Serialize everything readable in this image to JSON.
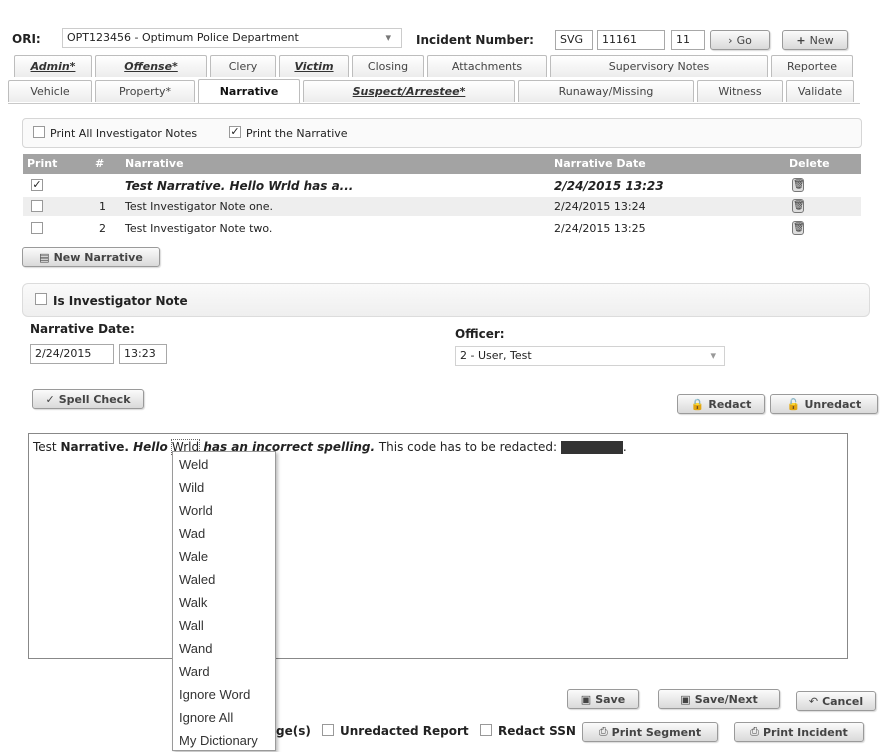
{
  "header": {
    "ori_label": "ORI:",
    "ori_value": "OPT123456 - Optimum Police Department",
    "incident_label": "Incident Number:",
    "incident_prefix": "SVG",
    "incident_number": "11161",
    "incident_suffix": "11",
    "go_label": "Go",
    "new_label": "New"
  },
  "tabs_row1": [
    "Admin*",
    "Offense*",
    "Clery",
    "Victim",
    "Closing",
    "Attachments",
    "Supervisory Notes",
    "Reportee"
  ],
  "tabs_row2": [
    "Vehicle",
    "Property*",
    "Narrative",
    "Suspect/Arrestee*",
    "Runaway/Missing",
    "Witness",
    "Validate"
  ],
  "print_options": {
    "print_all_notes": "Print All Investigator Notes",
    "print_narrative": "Print the Narrative"
  },
  "grid": {
    "headers": {
      "print": "Print",
      "num": "#",
      "narrative": "Narrative",
      "date": "Narrative Date",
      "delete": "Delete"
    },
    "rows": [
      {
        "num": "",
        "narrative": "Test Narrative. Hello Wrld has a...",
        "date": "2/24/2015 13:23"
      },
      {
        "num": "1",
        "narrative": "Test Investigator Note one.",
        "date": "2/24/2015 13:24"
      },
      {
        "num": "2",
        "narrative": "Test Investigator Note two.",
        "date": "2/24/2015 13:25"
      }
    ]
  },
  "new_narrative_label": "New Narrative",
  "form": {
    "investigator_note_label": "Is Investigator Note",
    "narrative_date_label": "Narrative Date:",
    "date_value": "2/24/2015",
    "time_value": "13:23",
    "officer_label": "Officer:",
    "officer_value": "2 - User, Test"
  },
  "toolbar": {
    "spell_check": "Spell Check",
    "redact": "Redact",
    "unredact": "Unredact"
  },
  "editor": {
    "text_1": "Test ",
    "text_2": "Narrative. ",
    "text_3": "Hello ",
    "misspelled": "Wrld",
    "text_4": " has an incorrect spelling.",
    "text_5": " This code has to be redacted: "
  },
  "spell_menu": [
    "Weld",
    "Wild",
    "World",
    "Wad",
    "Wale",
    "Waled",
    "Walk",
    "Wall",
    "Wand",
    "Ward",
    "Ignore Word",
    "Ignore All",
    "My Dictionary"
  ],
  "footer": {
    "save": "Save",
    "save_next": "Save/Next",
    "cancel": "Cancel",
    "partial_label": "ge(s)",
    "unredacted_report": "Unredacted Report",
    "redact_ssn": "Redact SSN",
    "print_segment": "Print Segment",
    "print_incident": "Print Incident"
  }
}
